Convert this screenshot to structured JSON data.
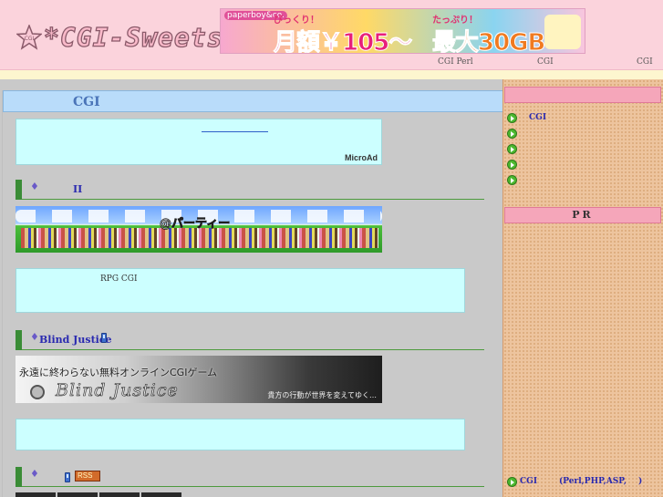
{
  "header": {
    "logo_text": "*CGI-Sweets*",
    "logo_badge": "CGI",
    "banner": {
      "brand": "paperboy&co.",
      "line1_top": "びっくり！",
      "line1_big": "月額￥105〜",
      "line2_top": "たっぷり！",
      "line2_big": "最大30GB"
    },
    "nav": [
      "CGI   Perl",
      "CGI",
      "CGI"
    ]
  },
  "main": {
    "title": "CGI",
    "ad_label": "MicroAd",
    "sections": [
      {
        "title": "II"
      },
      {
        "title": "Blind Justice"
      },
      {
        "rss_label": "RSS"
      }
    ],
    "party_banner_logo": "@パーティー",
    "desc1": "RPG   CGI",
    "blind_justice": {
      "tagline": "永遠に終わらない無料オンラインCGIゲーム",
      "logo": "Blind Justice",
      "sub": "貴方の行動が世界を変えてゆく…"
    }
  },
  "sidebar": {
    "heading2": "PR",
    "items": [
      "CGI",
      "",
      "",
      "",
      ""
    ],
    "bottom_item": {
      "a": "CGI",
      "b": "(Perl,PHP,ASP,",
      "c": ")"
    }
  },
  "colors": {
    "header_bg": "#fbd3dc",
    "title_bar": "#b9dcfa",
    "cyan_box": "#ccffff",
    "section_green": "#3a8c36",
    "sidebar_bg": "#edc49e",
    "sidebar_head": "#f5a6ba",
    "link_blue": "#2a2ab0"
  }
}
